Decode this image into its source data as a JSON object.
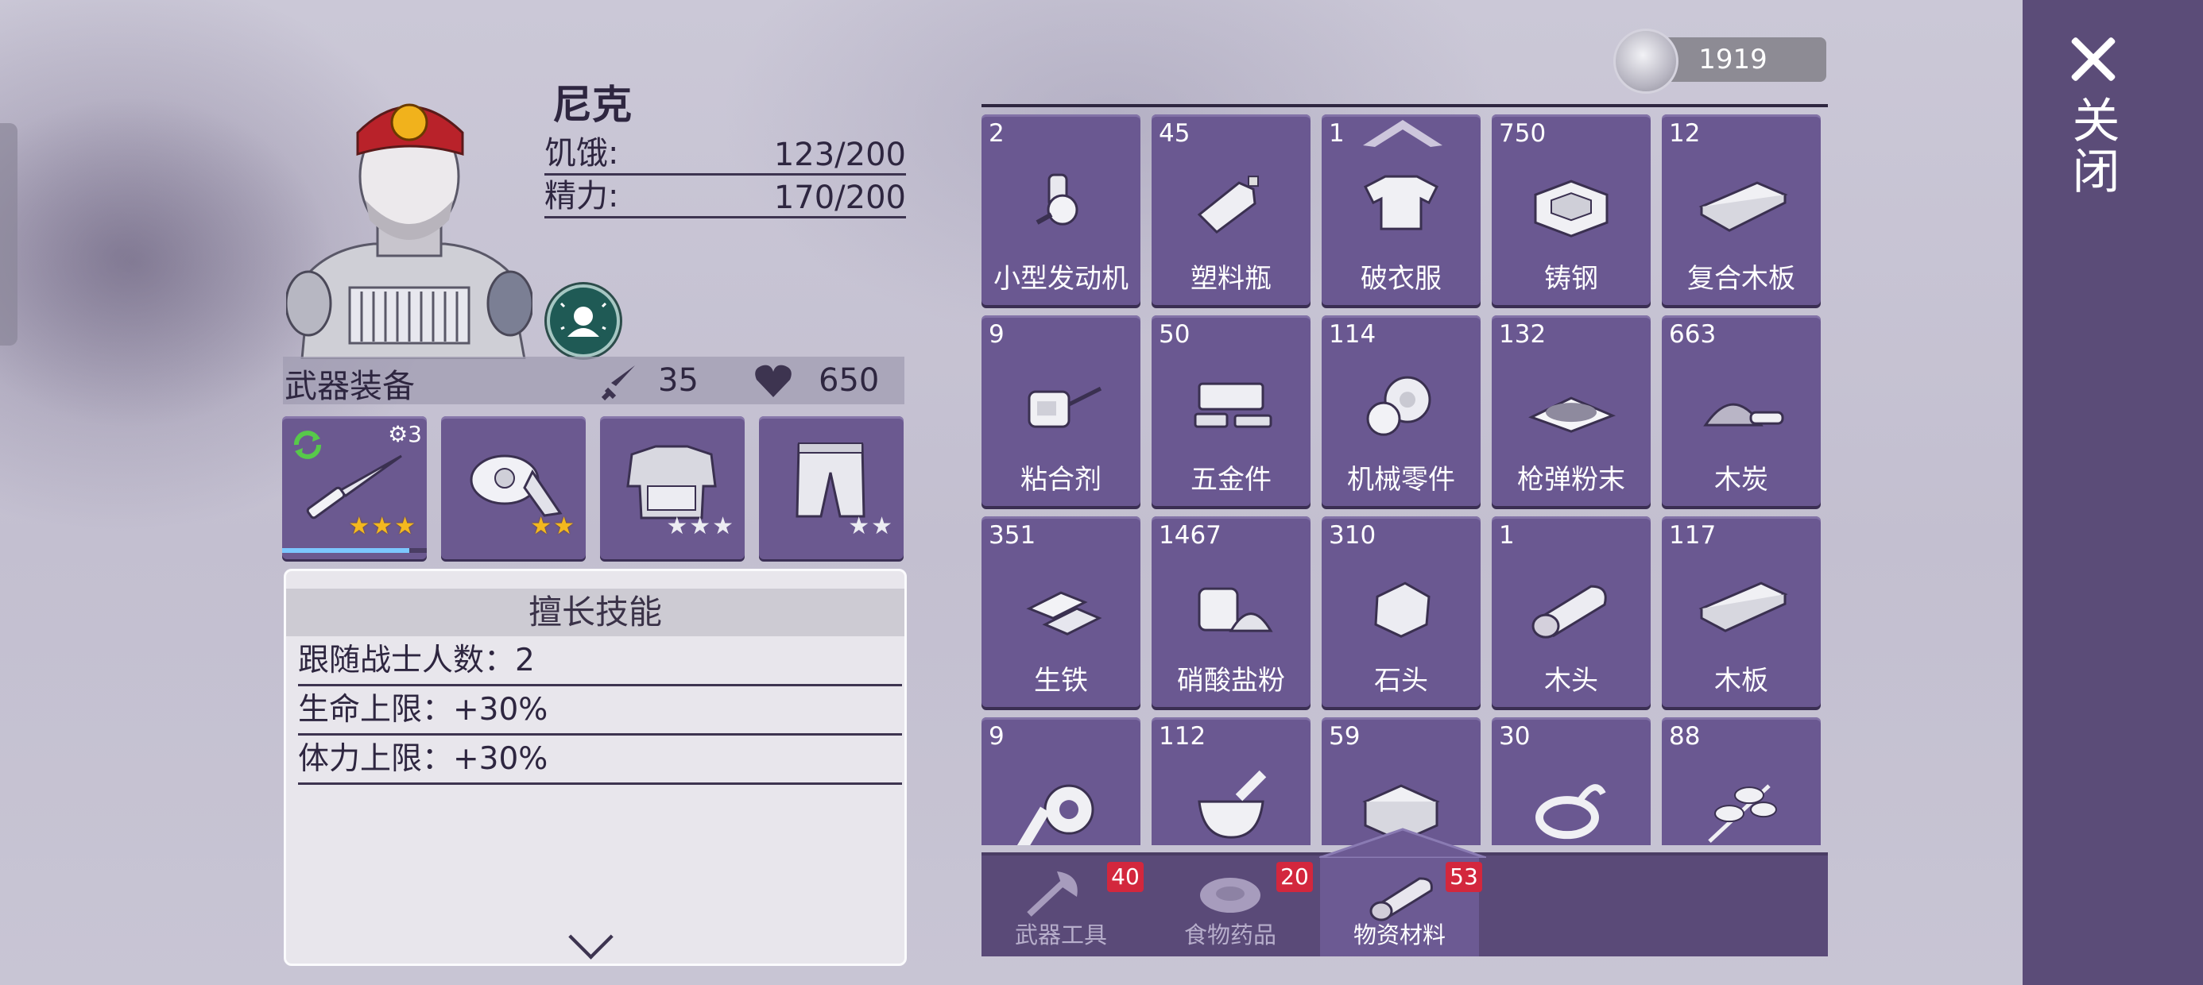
{
  "sidebar": {
    "close_label": "关闭"
  },
  "character": {
    "name": "尼克",
    "stats": [
      {
        "label": "饥饿:",
        "value": "123/200"
      },
      {
        "label": "精力:",
        "value": "170/200"
      }
    ]
  },
  "equipment": {
    "title": "武器装备",
    "attack": "35",
    "health": "650",
    "slots": [
      {
        "item": "knife",
        "gear_level": "3",
        "stars_gold": 3,
        "stars_white": 0,
        "durability": 0.88
      },
      {
        "item": "bandana",
        "stars_gold": 2,
        "stars_white": 0
      },
      {
        "item": "armor-vest",
        "stars_gold": 0,
        "stars_white": 3
      },
      {
        "item": "pants",
        "stars_gold": 0,
        "stars_white": 2
      }
    ]
  },
  "skills": {
    "title": "擅长技能",
    "items": [
      "跟随战士人数：2",
      "生命上限：+30%",
      "体力上限：+30%"
    ]
  },
  "inventory": {
    "coins": "1919",
    "items": [
      {
        "count": "2",
        "name": "小型发动机",
        "icon": "engine-icon"
      },
      {
        "count": "45",
        "name": "塑料瓶",
        "icon": "plastic-bottle-icon"
      },
      {
        "count": "1",
        "name": "破衣服",
        "icon": "torn-clothes-icon"
      },
      {
        "count": "750",
        "name": "铸钢",
        "icon": "cast-steel-icon"
      },
      {
        "count": "12",
        "name": "复合木板",
        "icon": "plywood-icon"
      },
      {
        "count": "9",
        "name": "粘合剂",
        "icon": "glue-icon"
      },
      {
        "count": "50",
        "name": "五金件",
        "icon": "hardware-icon"
      },
      {
        "count": "114",
        "name": "机械零件",
        "icon": "gear-parts-icon"
      },
      {
        "count": "132",
        "name": "枪弹粉末",
        "icon": "gunpowder-icon"
      },
      {
        "count": "663",
        "name": "木炭",
        "icon": "charcoal-icon"
      },
      {
        "count": "351",
        "name": "生铁",
        "icon": "pig-iron-icon"
      },
      {
        "count": "1467",
        "name": "硝酸盐粉",
        "icon": "nitrate-powder-icon"
      },
      {
        "count": "310",
        "name": "石头",
        "icon": "stone-icon"
      },
      {
        "count": "1",
        "name": "木头",
        "icon": "log-icon"
      },
      {
        "count": "117",
        "name": "木板",
        "icon": "plank-icon"
      },
      {
        "count": "9",
        "name": "",
        "icon": "tape-icon"
      },
      {
        "count": "112",
        "name": "",
        "icon": "mortar-icon"
      },
      {
        "count": "59",
        "name": "",
        "icon": "metal-box-icon"
      },
      {
        "count": "30",
        "name": "",
        "icon": "rope-icon"
      },
      {
        "count": "88",
        "name": "",
        "icon": "herb-icon"
      }
    ]
  },
  "tabs": [
    {
      "label": "武器工具",
      "badge": "40",
      "icon": "axe-icon"
    },
    {
      "label": "食物药品",
      "badge": "20",
      "icon": "meat-icon"
    },
    {
      "label": "物资材料",
      "badge": "53",
      "icon": "log-icon",
      "active": true
    }
  ],
  "colors": {
    "panel": "#6a5891",
    "sidebar": "#5b4c78",
    "badge": "#d3273d",
    "star": "#f3b81f"
  }
}
